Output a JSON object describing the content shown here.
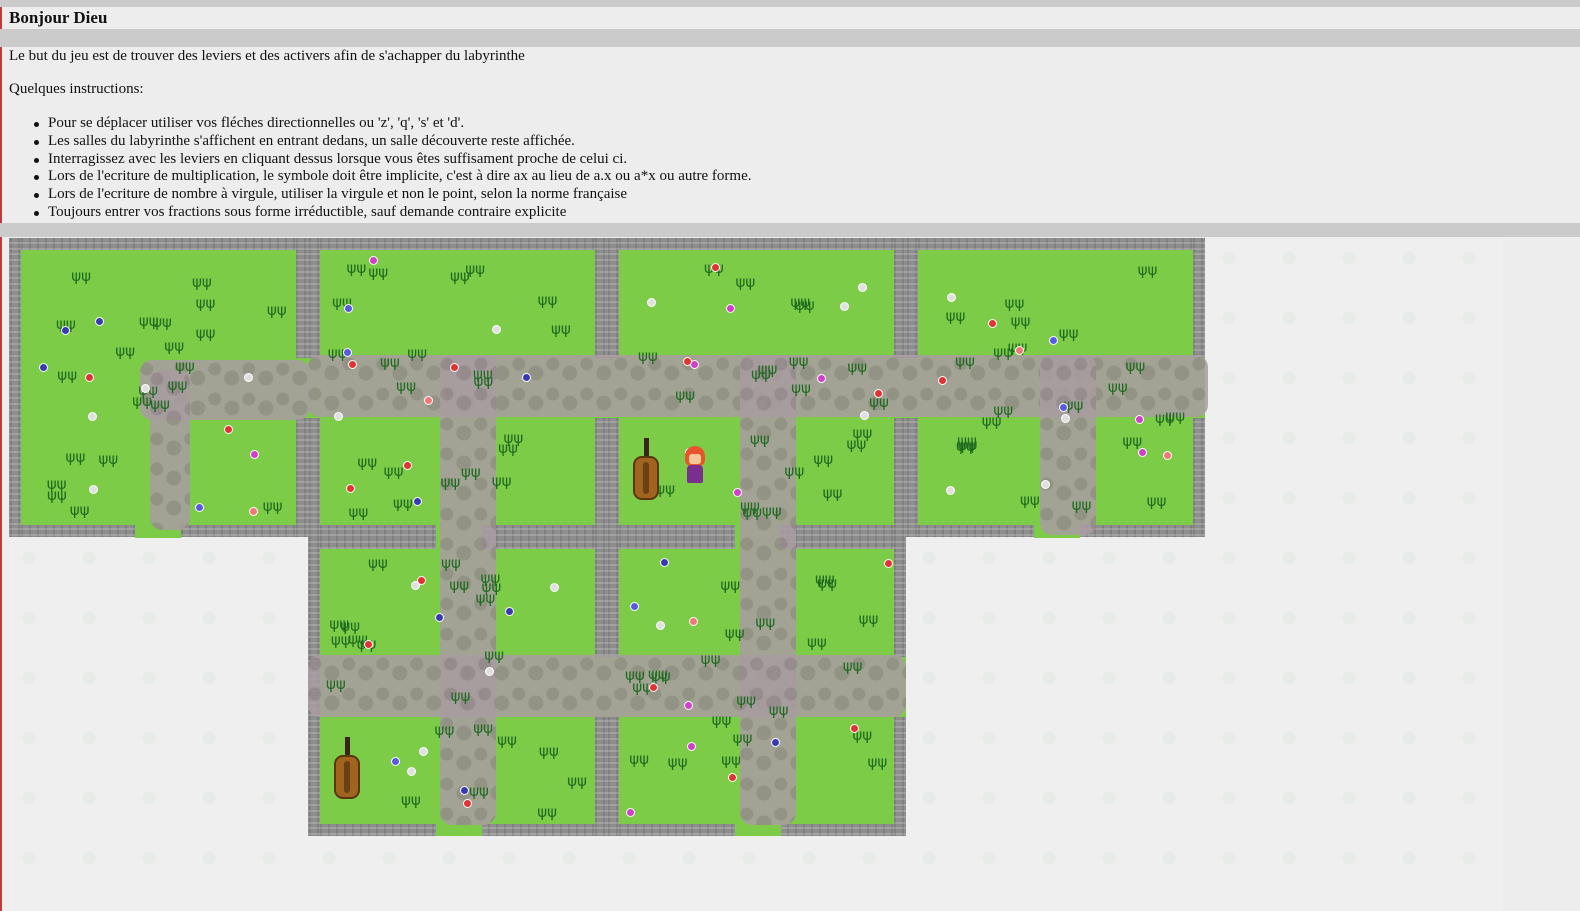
{
  "page": {
    "title": "Bonjour Dieu",
    "intro": "Le but du jeu est de trouver des leviers et des activers afin de s'achapper du labyrinthe",
    "instructions_heading": "Quelques instructions:",
    "instructions": [
      "Pour se déplacer utiliser vos fléches directionnelles ou 'z', 'q', 's' et 'd'.",
      "Les salles du labyrinthe s'affichent en entrant dedans, un salle découverte reste affichée.",
      "Interragissez avec les leviers en cliquant dessus lorsque vous êtes suffisament proche de celui ci.",
      "Lors de l'ecriture de multiplication, le symbole doit être implicite, c'est à dire ax au lieu de a.x ou a*x ou autre forme.",
      "Lors de l'ecriture de nombre à virgule, utiliser la virgule et non le point, selon la norme française",
      "Toujours entrer vos fractions sous forme irréductible, sauf demande contraire explicite"
    ]
  },
  "maze": {
    "rooms_discovered": 6,
    "levers": 2,
    "player": "player-character",
    "colors": {
      "grass": "#7ccc48",
      "wall": "#8e8e8e",
      "path": "#a99da2"
    }
  }
}
